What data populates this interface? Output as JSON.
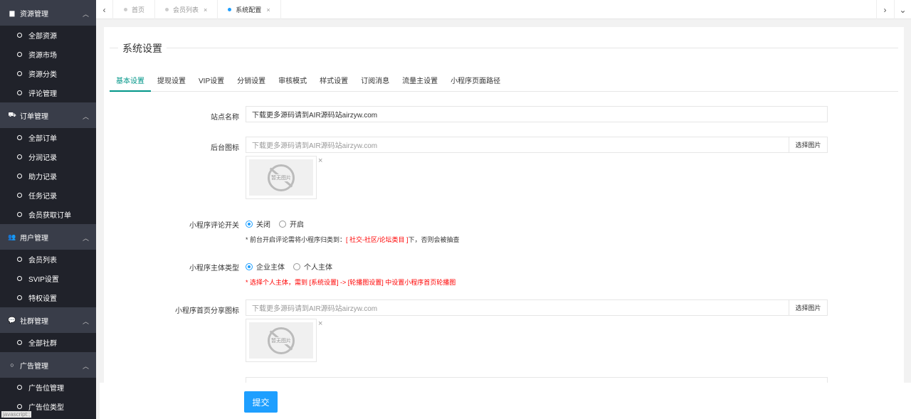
{
  "sidebar": {
    "groups": [
      {
        "label": "资源管理",
        "icon": "book-icon",
        "items": [
          "全部资源",
          "资源市场",
          "资源分类",
          "评论管理"
        ]
      },
      {
        "label": "订单管理",
        "icon": "cart-icon",
        "items": [
          "全部订单",
          "分润记录",
          "助力记录",
          "任务记录",
          "会员获取订单"
        ]
      },
      {
        "label": "用户管理",
        "icon": "users-icon",
        "items": [
          "会员列表",
          "SVIP设置",
          "特权设置"
        ]
      },
      {
        "label": "社群管理",
        "icon": "chat-icon",
        "items": [
          "全部社群"
        ]
      },
      {
        "label": "广告管理",
        "icon": "circle-icon",
        "items": [
          "广告位管理",
          "广告位类型"
        ]
      }
    ],
    "footer_tip": "javascript:;"
  },
  "tabbar": {
    "tabs": [
      {
        "label": "首页",
        "closable": false,
        "active": false
      },
      {
        "label": "会员列表",
        "closable": true,
        "active": false
      },
      {
        "label": "系统配置",
        "closable": true,
        "active": true
      }
    ],
    "close_glyph": "×"
  },
  "panel": {
    "title": "系统设置",
    "subtabs": [
      "基本设置",
      "提现设置",
      "VIP设置",
      "分销设置",
      "审核模式",
      "样式设置",
      "订阅消息",
      "流量主设置",
      "小程序页面路径"
    ],
    "active_subtab": 0,
    "site_name": {
      "label": "站点名称",
      "value": "下载更多源码请到AIR源码站airzyw.com"
    },
    "admin_icon": {
      "label": "后台图标",
      "placeholder": "下载更多源码请到AIR源码站airzyw.com",
      "button": "选择图片",
      "no_image": "暂无图片"
    },
    "comment_switch": {
      "label": "小程序评论开关",
      "options": [
        "关闭",
        "开启"
      ],
      "selected": 0,
      "help_prefix": "* 前台开启评论需将小程序归类到：",
      "help_red": "[ 社交-社区/论坛类目 ]",
      "help_suffix": "下，否则会被抽查"
    },
    "subject_type": {
      "label": "小程序主体类型",
      "options": [
        "企业主体",
        "个人主体"
      ],
      "selected": 0,
      "help": "* 选择个人主体，需到 [系统设置] -> [轮播图设置] 中设置小程序首页轮播图"
    },
    "share_icon": {
      "label": "小程序首页分享图标",
      "placeholder": "下载更多源码请到AIR源码站airzyw.com",
      "button": "选择图片",
      "no_image": "暂无图片"
    },
    "submit": "提交"
  },
  "colors": {
    "accent": "#009688",
    "primary": "#1e9fff",
    "sidebar_bg": "#20222a",
    "sidebar_group_bg": "#393d49",
    "warn": "#ff0000"
  }
}
